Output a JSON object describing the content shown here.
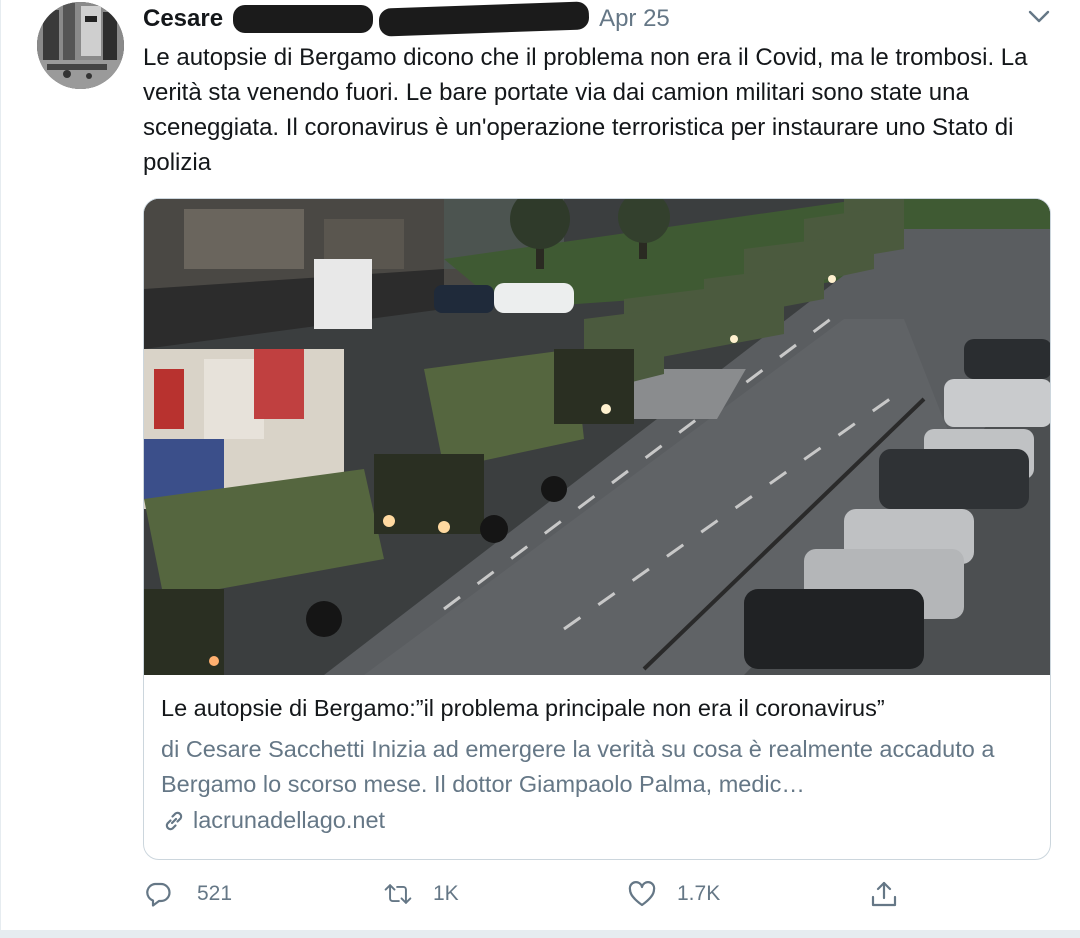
{
  "author": {
    "display_name": "Cesare"
  },
  "date": "Apr 25",
  "icons": {
    "menu": "chevron-down-icon",
    "link": "link-icon",
    "reply": "reply-icon",
    "retweet": "retweet-icon",
    "like": "heart-icon",
    "share": "share-icon"
  },
  "tweet": {
    "text": "Le autopsie di Bergamo dicono che il problema non era il Covid, ma le trombosi. La verità sta venendo fuori. Le bare portate via dai camion militari sono state una sceneggiata. Il coronavirus è un'operazione terroristica per instaurare uno Stato di polizia"
  },
  "card": {
    "title": "Le autopsie di Bergamo:”il problema principale non era il coronavirus”",
    "description": "di Cesare Sacchetti Inizia ad emergere la verità su cosa è realmente accaduto a Bergamo lo scorso mese. Il dottor Giampaolo Palma, medic…",
    "domain": "lacrunadellago.net"
  },
  "actions": {
    "reply_count": "521",
    "retweet_count": "1K",
    "like_count": "1.7K"
  },
  "colors": {
    "text": "#14171a",
    "secondary": "#657786",
    "border": "#ccd6dd"
  }
}
